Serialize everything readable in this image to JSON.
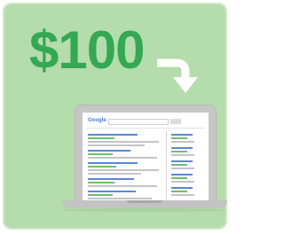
{
  "price": {
    "text": "$100"
  },
  "search": {
    "logo_text": "Google"
  },
  "colors": {
    "background": "#b5dcac",
    "price_green": "#34a853",
    "arrow_white": "#ffffff",
    "laptop_gray": "#c7c7c7",
    "link_blue": "#5a87d8",
    "url_green": "#6cc06a"
  },
  "icons": [
    "curved-arrow-icon",
    "laptop-icon"
  ]
}
